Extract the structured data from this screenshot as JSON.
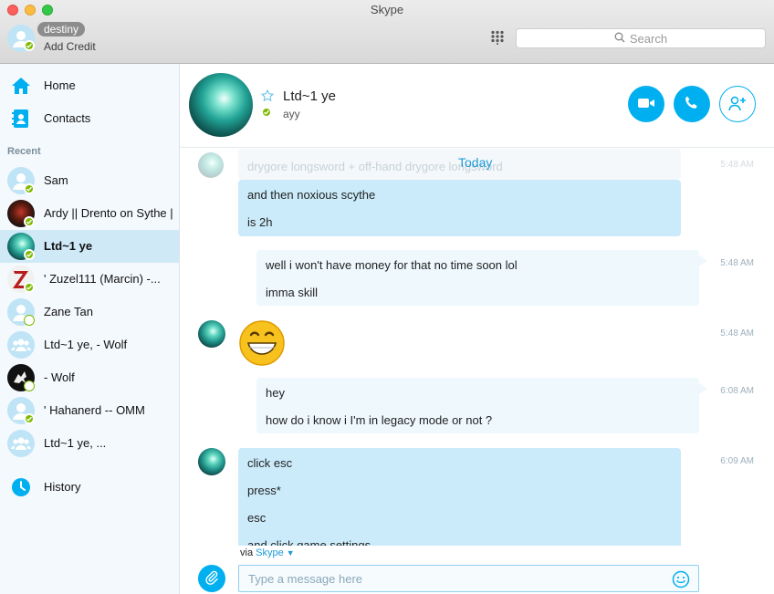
{
  "window": {
    "title": "Skype"
  },
  "me": {
    "name": "destiny",
    "add_credit": "Add Credit"
  },
  "search": {
    "placeholder": "Search"
  },
  "nav": {
    "home": "Home",
    "contacts": "Contacts",
    "recent_header": "Recent",
    "history": "History"
  },
  "contacts": [
    {
      "name": "Sam",
      "avatar": "default",
      "status": "online"
    },
    {
      "name": "Ardy || Drento on Sythe ||",
      "avatar": "photo-dark",
      "status": "online"
    },
    {
      "name": "Ltd~1 ye",
      "avatar": "photo-teal",
      "status": "online",
      "selected": true
    },
    {
      "name": "' Zuzel111 (Marcin) -...",
      "avatar": "photo-z",
      "status": "online"
    },
    {
      "name": "Zane Tan",
      "avatar": "default",
      "status": "offline"
    },
    {
      "name": "Ltd~1 ye, - Wolf",
      "avatar": "group",
      "status": "none"
    },
    {
      "name": "- Wolf",
      "avatar": "photo-wolf",
      "status": "offline"
    },
    {
      "name": "' Hahanerd -- OMM",
      "avatar": "default",
      "status": "online"
    },
    {
      "name": "Ltd~1 ye, ...",
      "avatar": "group",
      "status": "none"
    }
  ],
  "chat": {
    "title": "Ltd~1 ye",
    "mood": "ayy",
    "today_label": "Today",
    "messages": [
      {
        "lines": [
          "drygore longsword + off-hand drygore longsword",
          "and then noxious scythe",
          "is 2h"
        ],
        "time": "5:48 AM",
        "direction": "in"
      },
      {
        "lines": [
          "well i won't have money for that no time soon lol",
          "imma skill"
        ],
        "time": "5:48 AM",
        "direction": "out"
      },
      {
        "lines": [
          "😁"
        ],
        "time": "5:48 AM",
        "direction": "in"
      },
      {
        "lines": [
          "hey",
          "how do i know i I'm in legacy mode or not ?"
        ],
        "time": "6:08 AM",
        "direction": "out"
      },
      {
        "lines": [
          "click esc",
          "press*",
          "esc",
          "and click game settings"
        ],
        "time": "6:09 AM",
        "direction": "in"
      }
    ],
    "via_prefix": "via",
    "via_brand": "Skype",
    "composer_placeholder": "Type a message here"
  },
  "colors": {
    "accent": "#00aff0",
    "online": "#7fba00",
    "incoming_bubble": "#cbebfa",
    "outgoing_bubble": "#eef8fd"
  },
  "icons": [
    "home-icon",
    "contacts-icon",
    "history-icon",
    "dialpad-icon",
    "search-icon",
    "video-call-icon",
    "phone-icon",
    "add-contact-icon",
    "favorite-star-icon",
    "attach-icon",
    "emoticon-icon"
  ]
}
